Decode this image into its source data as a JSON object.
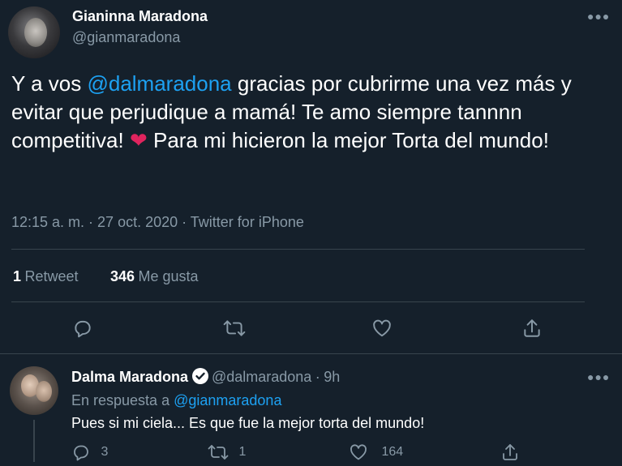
{
  "main_tweet": {
    "author_name": "Gianinna Maradona",
    "author_handle": "@gianmaradona",
    "text_before_mention": "Y a vos ",
    "mention": "@dalmaradona",
    "text_after_mention": " gracias por cubrirme una vez más y evitar que perjudique a mamá! Te amo siempre tannnn competitiva! ",
    "heart": "❤️",
    "text_after_heart": " Para mi hicieron la mejor Torta del mundo!",
    "timestamp": "12:15 a. m. · 27 oct. 2020 · Twitter for iPhone",
    "retweets_count": "1",
    "retweets_label": "Retweet",
    "likes_count": "346",
    "likes_label": "Me gusta",
    "more_icon": "more-horizontal-icon"
  },
  "reply_tweet": {
    "author_name": "Dalma Maradona",
    "verified": true,
    "author_handle": "@dalmaradona",
    "separator": "·",
    "time": "9h",
    "replying_prefix": "En respuesta a",
    "replying_to": "@gianmaradona",
    "text": "Pues si mi ciela... Es que fue la mejor torta del mundo!",
    "reply_count": "3",
    "retweet_count": "1",
    "like_count": "164"
  },
  "colors": {
    "background": "#15202b",
    "secondary_text": "#8899a6",
    "accent": "#1da1f2",
    "heart": "#e0245e",
    "divider": "#38444d"
  }
}
